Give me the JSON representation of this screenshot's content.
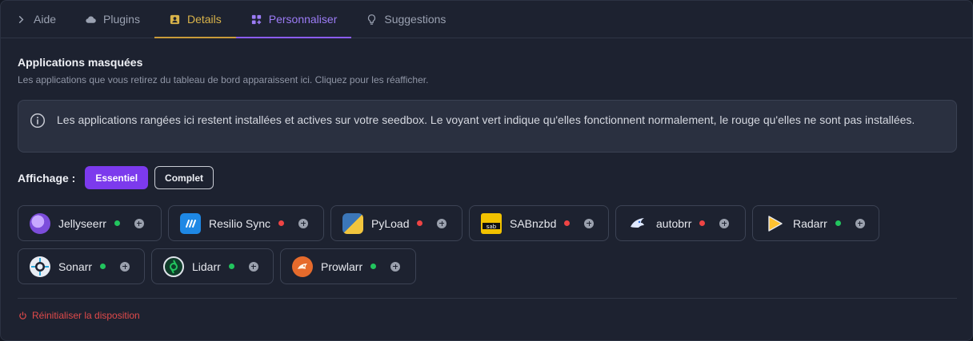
{
  "tabs": [
    {
      "label": "Aide",
      "icon": "chevron-right-icon"
    },
    {
      "label": "Plugins",
      "icon": "cloud-icon"
    },
    {
      "label": "Details",
      "icon": "contact-card-icon"
    },
    {
      "label": "Personnaliser",
      "icon": "grid-plus-icon"
    },
    {
      "label": "Suggestions",
      "icon": "lightbulb-icon"
    }
  ],
  "section": {
    "title": "Applications masquées",
    "subtitle": "Les applications que vous retirez du tableau de bord apparaissent ici. Cliquez pour les réafficher."
  },
  "info": {
    "text": "Les applications rangées ici restent installées et actives sur votre seedbox. Le voyant vert indique qu'elles fonctionnent normalement, le rouge qu'elles ne sont pas installées."
  },
  "display": {
    "label": "Affichage :",
    "options": [
      "Essentiel",
      "Complet"
    ],
    "selected": "Essentiel"
  },
  "apps": [
    {
      "name": "Jellyseerr",
      "status": "green"
    },
    {
      "name": "Resilio Sync",
      "status": "red"
    },
    {
      "name": "PyLoad",
      "status": "red"
    },
    {
      "name": "SABnzbd",
      "status": "red"
    },
    {
      "name": "autobrr",
      "status": "red"
    },
    {
      "name": "Radarr",
      "status": "green"
    },
    {
      "name": "Sonarr",
      "status": "green"
    },
    {
      "name": "Lidarr",
      "status": "green"
    },
    {
      "name": "Prowlarr",
      "status": "green"
    }
  ],
  "reset_label": "Réinitialiser la disposition",
  "colors": {
    "accent": "#7c3aed",
    "details_tab": "#d9b34a",
    "status_green": "#22c55e",
    "status_red": "#ef4444",
    "danger": "#e04a4a"
  }
}
